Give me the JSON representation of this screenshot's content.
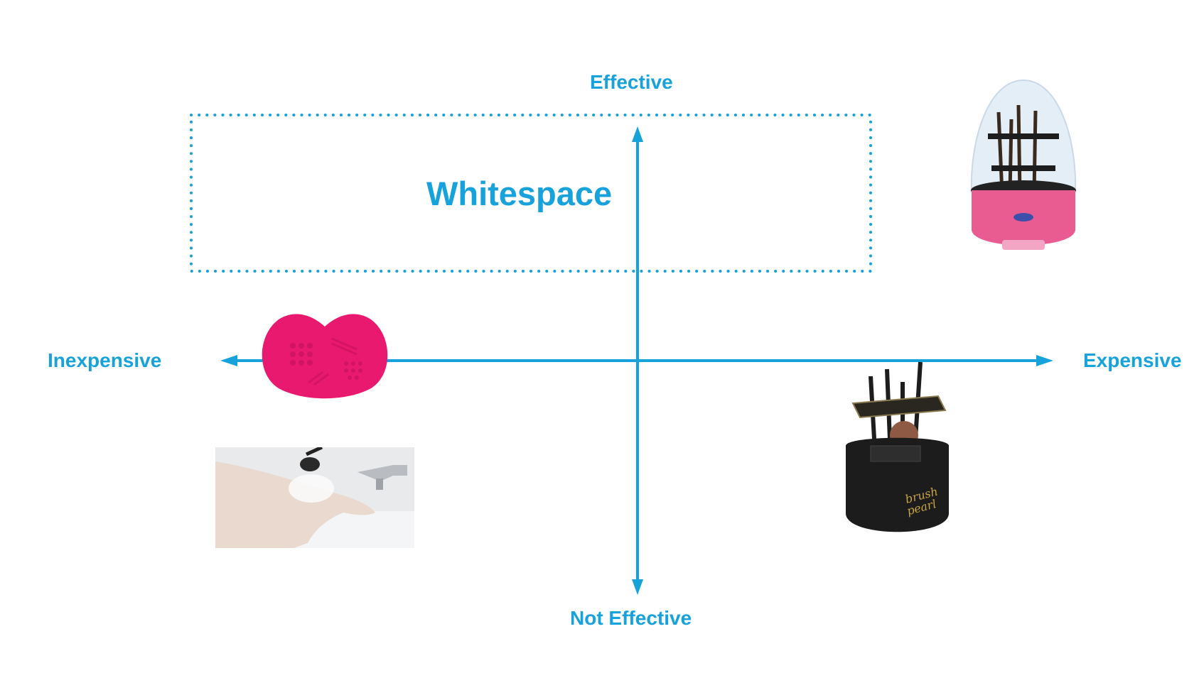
{
  "axes": {
    "top": "Effective",
    "bottom": "Not Effective",
    "left": "Inexpensive",
    "right": "Expensive"
  },
  "region": {
    "label": "Whitespace"
  },
  "products": [
    {
      "name": "silicone-brush-cleaning-pad",
      "color": "#e8196e"
    },
    {
      "name": "hand-washing-brush-photo"
    },
    {
      "name": "egg-shaped-brush-cleaner-machine",
      "color": "#e95c91"
    },
    {
      "name": "brush-pearl-cleaner-machine",
      "brand_text": "brush pearl",
      "color": "#1c1c1c"
    }
  ],
  "colors": {
    "accent": "#17a2dc"
  }
}
